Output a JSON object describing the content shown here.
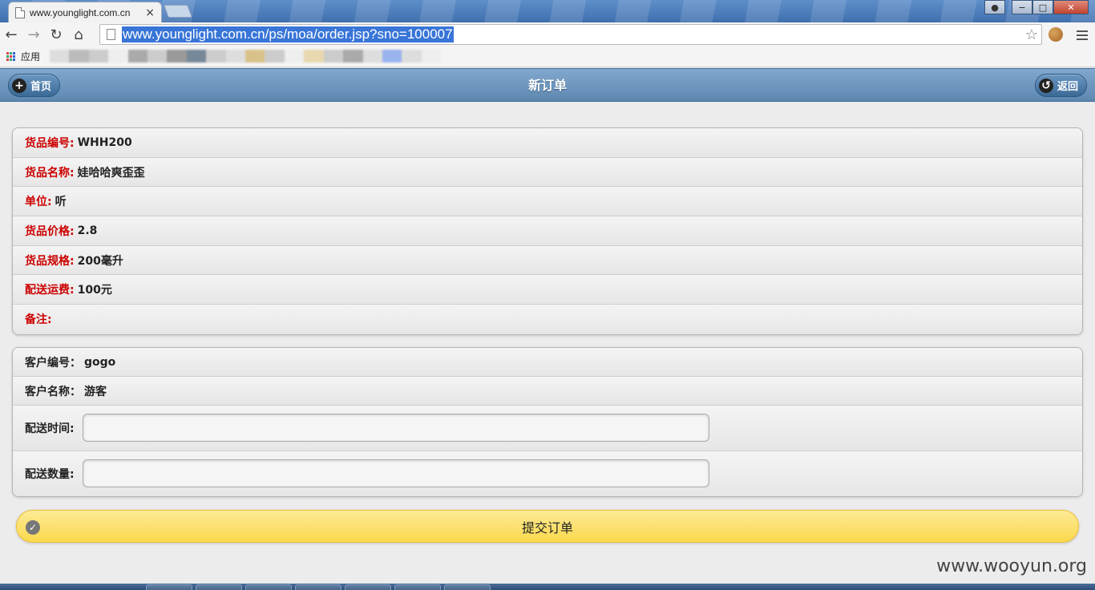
{
  "browser": {
    "tab_title": "www.younglight.com.cn",
    "tab_close": "×",
    "url": "www.younglight.com.cn/ps/moa/order.jsp?sno=100007",
    "star": "☆",
    "nav": {
      "back": "←",
      "forward": "→",
      "reload": "↻",
      "home": "⌂"
    },
    "bookmarks": {
      "apps_label": "应用"
    },
    "window": {
      "minimize": "−",
      "maximize": "□",
      "close": "✕"
    }
  },
  "header": {
    "home_label": "首页",
    "home_icon": "+",
    "title": "新订单",
    "back_label": "返回",
    "back_icon": "↺"
  },
  "product": {
    "items": [
      {
        "label": "货品编号:",
        "value": "WHH200"
      },
      {
        "label": "货品名称:",
        "value": "娃哈哈爽歪歪"
      },
      {
        "label": "单位:",
        "value": "听"
      },
      {
        "label": "货品价格:",
        "value": "2.8"
      },
      {
        "label": "货品规格:",
        "value": "200毫升"
      },
      {
        "label": "配送运费:",
        "value": "100元"
      },
      {
        "label": "备注:",
        "value": ""
      }
    ]
  },
  "customer": {
    "id_label": "客户编号：",
    "id_value": "gogo",
    "name_label": "客户名称：",
    "name_value": "游客",
    "time_label": "配送时间:",
    "time_value": "",
    "qty_label": "配送数量:",
    "qty_value": ""
  },
  "submit": {
    "label": "提交订单",
    "icon": "✓"
  },
  "watermark": "www.wooyun.org",
  "colors": {
    "header": "#6a93bb",
    "label_red": "#cc0000",
    "submit_yellow": "#fbd84c",
    "url_highlight": "#3875d7"
  }
}
